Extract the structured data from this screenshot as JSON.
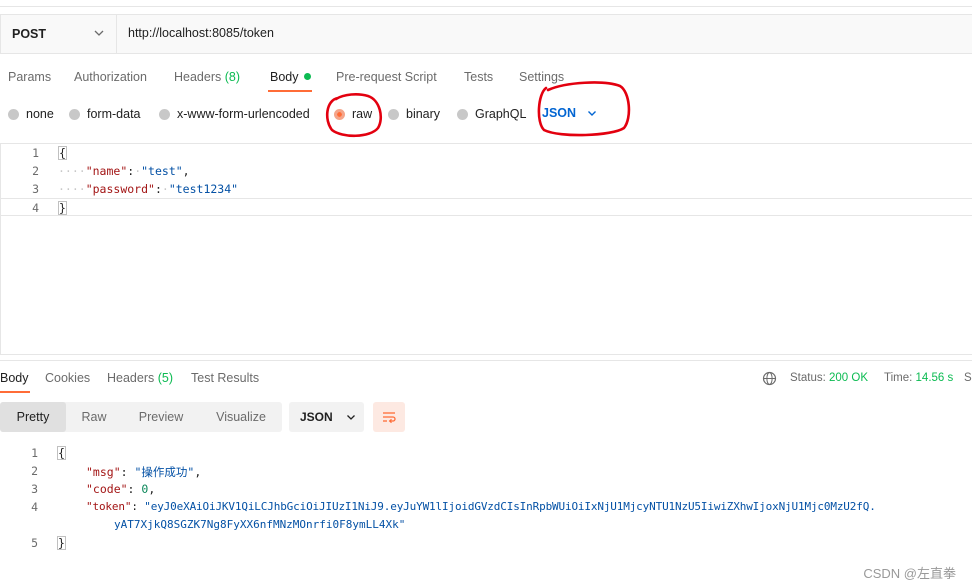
{
  "request": {
    "method": "POST",
    "url": "http://localhost:8085/token",
    "tabs": {
      "params": "Params",
      "authorization": "Authorization",
      "headers": "Headers",
      "headers_count": "(8)",
      "body": "Body",
      "pre_request": "Pre-request Script",
      "tests": "Tests",
      "settings": "Settings"
    },
    "body_types": {
      "none": "none",
      "form_data": "form-data",
      "urlencoded": "x-www-form-urlencoded",
      "raw": "raw",
      "binary": "binary",
      "graphql": "GraphQL"
    },
    "selected_body_type": "raw",
    "language": "JSON",
    "code": {
      "l1": "1",
      "l2": "2",
      "l3": "3",
      "l4": "4",
      "open": "{",
      "indent": "····",
      "name_key": "\"name\"",
      "name_val": "\"test\"",
      "pass_key": "\"password\"",
      "pass_val": "\"test1234\"",
      "close": "}"
    }
  },
  "response": {
    "tabs": {
      "body": "Body",
      "cookies": "Cookies",
      "headers": "Headers",
      "headers_count": "(5)",
      "test_results": "Test Results"
    },
    "status_label": "Status:",
    "status_value": "200 OK",
    "time_label": "Time:",
    "time_value": "14.56 s",
    "size_cut": "S",
    "views": {
      "pretty": "Pretty",
      "raw": "Raw",
      "preview": "Preview",
      "visualize": "Visualize"
    },
    "format": "JSON",
    "code": {
      "l1": "1",
      "l2": "2",
      "l3": "3",
      "l4": "4",
      "l5": "5",
      "open": "{",
      "msg_key": "\"msg\"",
      "msg_val": "\"操作成功\"",
      "code_key": "\"code\"",
      "code_val": "0",
      "token_key": "\"token\"",
      "token_val_1": "\"eyJ0eXAiOiJKV1QiLCJhbGciOiJIUzI1NiJ9.eyJuYW1lIjoidGVzdCIsInRpbWUiOiIxNjU1MjcyNTU1NzU5IiwiZXhwIjoxNjU1Mjc0MzU2fQ.",
      "token_val_2": "yAT7XjkQ8SGZK7Ng8FyXX6nfMNzMOnrfi0F8ymLL4Xk\"",
      "close": "}"
    }
  },
  "watermark": "CSDN @左直拳",
  "colors": {
    "accent": "#ff6c37",
    "success": "#0cbb52",
    "link_blue": "#0265d2",
    "annotation_red": "#e3000f"
  }
}
